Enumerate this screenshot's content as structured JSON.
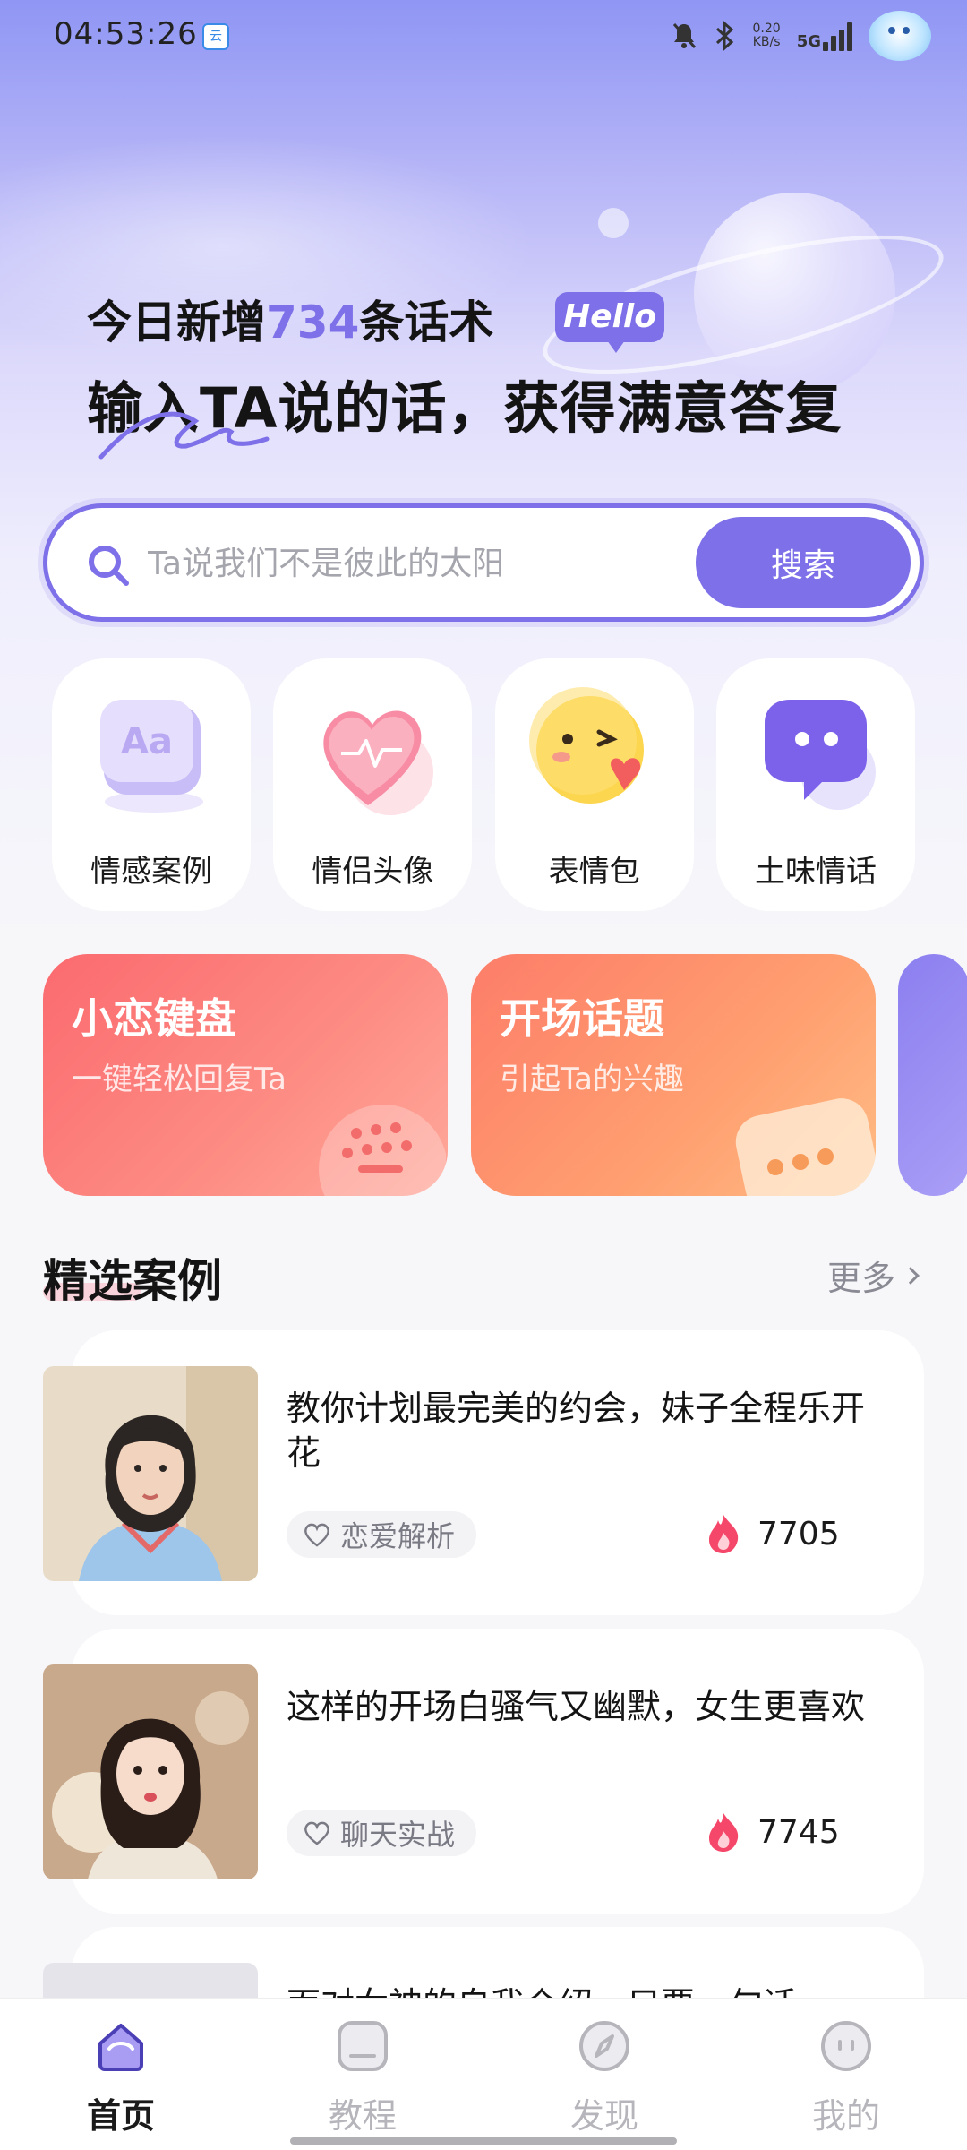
{
  "status_bar": {
    "time": "04:53:26",
    "speed_value": "0.20",
    "speed_unit": "KB/s",
    "network": "5G"
  },
  "hero": {
    "headline_prefix": "今日新增",
    "headline_count": "734",
    "headline_suffix": "条话术",
    "badge": "Hello",
    "subheadline": "输入TA说的话，获得满意答复"
  },
  "search": {
    "placeholder": "Ta说我们不是彼此的太阳",
    "button_label": "搜索"
  },
  "categories": [
    {
      "label": "情感案例",
      "icon": "aa-cube-icon"
    },
    {
      "label": "情侣头像",
      "icon": "heart-icon"
    },
    {
      "label": "表情包",
      "icon": "emoji-wink-icon"
    },
    {
      "label": "土味情话",
      "icon": "chat-bubble-icon"
    }
  ],
  "features": [
    {
      "title": "小恋键盘",
      "subtitle": "一键轻松回复Ta",
      "icon": "keyboard-icon"
    },
    {
      "title": "开场话题",
      "subtitle": "引起Ta的兴趣",
      "icon": "typing-bubble-icon"
    }
  ],
  "featured": {
    "title": "精选案例",
    "more_label": "更多",
    "items": [
      {
        "title": "教你计划最完美的约会，妹子全程乐开花",
        "tag": "恋爱解析",
        "count": "7705"
      },
      {
        "title": "这样的开场白骚气又幽默，女生更喜欢",
        "tag": "聊天实战",
        "count": "7745"
      },
      {
        "title": "面对女神的自我介绍，只要一句话",
        "tag": "",
        "count": ""
      }
    ]
  },
  "bottom_nav": {
    "items": [
      {
        "label": "首页",
        "icon": "home-icon",
        "active": true
      },
      {
        "label": "教程",
        "icon": "tutorial-icon",
        "active": false
      },
      {
        "label": "发现",
        "icon": "compass-icon",
        "active": false
      },
      {
        "label": "我的",
        "icon": "profile-icon",
        "active": false
      }
    ]
  },
  "colors": {
    "accent": "#7d70e8",
    "keyboard_card": "#fb6a6f",
    "topic_card": "#fd8d6e",
    "flame": "#f5476a"
  }
}
